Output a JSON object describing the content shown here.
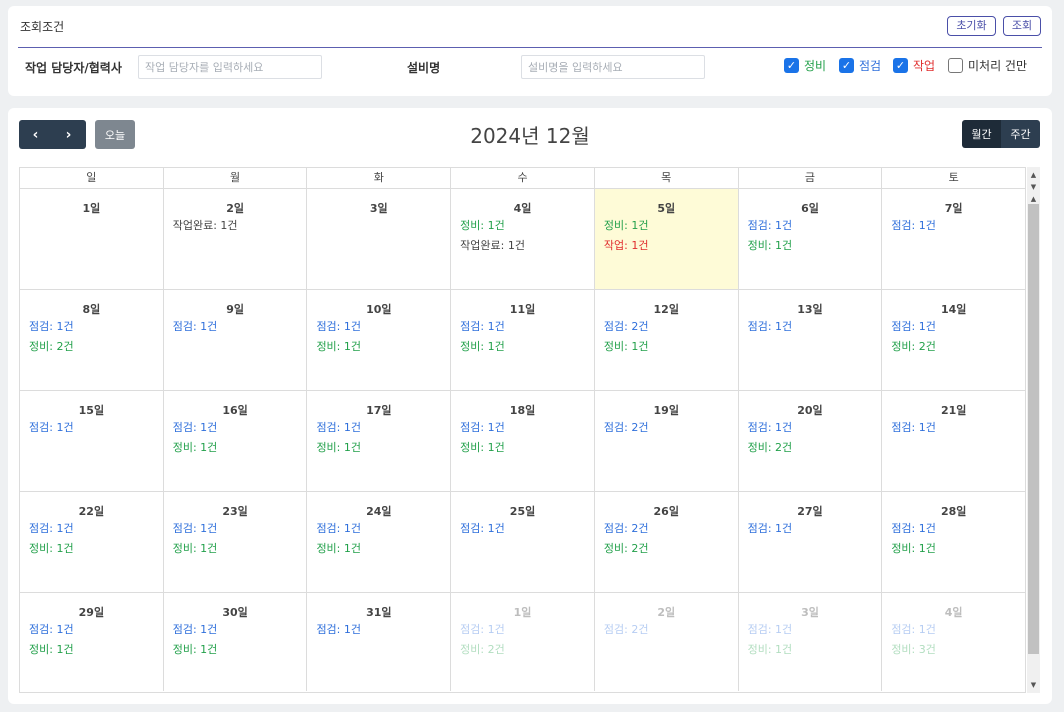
{
  "search": {
    "title": "조회조건",
    "reset_label": "초기화",
    "query_label": "조회",
    "worker_label": "작업 담당자/협력사",
    "worker_placeholder": "작업 담당자를 입력하세요",
    "equip_label": "설비명",
    "equip_placeholder": "설비명을 입력하세요",
    "filters": [
      {
        "label": "정비",
        "checked": true,
        "color": "#22a04a"
      },
      {
        "label": "점검",
        "checked": true,
        "color": "#2f6fdb"
      },
      {
        "label": "작업",
        "checked": true,
        "color": "#e02d2d"
      },
      {
        "label": "미처리 건만",
        "checked": false,
        "color": "#333333"
      }
    ]
  },
  "calendar": {
    "title": "2024년 12월",
    "prev_icon": "‹",
    "next_icon": "›",
    "today_label": "오늘",
    "month_label": "월간",
    "week_label": "주간",
    "weekdays": [
      "일",
      "월",
      "화",
      "수",
      "목",
      "금",
      "토"
    ],
    "weeks": [
      [
        {
          "day": "1일",
          "events": []
        },
        {
          "day": "2일",
          "events": [
            {
              "type": "done",
              "text": "작업완료: 1건"
            }
          ]
        },
        {
          "day": "3일",
          "events": []
        },
        {
          "day": "4일",
          "events": [
            {
              "type": "jeongbi",
              "text": "정비: 1건"
            },
            {
              "type": "done",
              "text": "작업완료: 1건"
            }
          ]
        },
        {
          "day": "5일",
          "today": true,
          "events": [
            {
              "type": "jeongbi",
              "text": "정비: 1건"
            },
            {
              "type": "jakeop",
              "text": "작업: 1건"
            }
          ]
        },
        {
          "day": "6일",
          "events": [
            {
              "type": "jeomgeom",
              "text": "점검: 1건"
            },
            {
              "type": "jeongbi",
              "text": "정비: 1건"
            }
          ]
        },
        {
          "day": "7일",
          "events": [
            {
              "type": "jeomgeom",
              "text": "점검: 1건"
            }
          ]
        }
      ],
      [
        {
          "day": "8일",
          "events": [
            {
              "type": "jeomgeom",
              "text": "점검: 1건"
            },
            {
              "type": "jeongbi",
              "text": "정비: 2건"
            }
          ]
        },
        {
          "day": "9일",
          "events": [
            {
              "type": "jeomgeom",
              "text": "점검: 1건"
            }
          ]
        },
        {
          "day": "10일",
          "events": [
            {
              "type": "jeomgeom",
              "text": "점검: 1건"
            },
            {
              "type": "jeongbi",
              "text": "정비: 1건"
            }
          ]
        },
        {
          "day": "11일",
          "events": [
            {
              "type": "jeomgeom",
              "text": "점검: 1건"
            },
            {
              "type": "jeongbi",
              "text": "정비: 1건"
            }
          ]
        },
        {
          "day": "12일",
          "events": [
            {
              "type": "jeomgeom",
              "text": "점검: 2건"
            },
            {
              "type": "jeongbi",
              "text": "정비: 1건"
            }
          ]
        },
        {
          "day": "13일",
          "events": [
            {
              "type": "jeomgeom",
              "text": "점검: 1건"
            }
          ]
        },
        {
          "day": "14일",
          "events": [
            {
              "type": "jeomgeom",
              "text": "점검: 1건"
            },
            {
              "type": "jeongbi",
              "text": "정비: 2건"
            }
          ]
        }
      ],
      [
        {
          "day": "15일",
          "events": [
            {
              "type": "jeomgeom",
              "text": "점검: 1건"
            }
          ]
        },
        {
          "day": "16일",
          "events": [
            {
              "type": "jeomgeom",
              "text": "점검: 1건"
            },
            {
              "type": "jeongbi",
              "text": "정비: 1건"
            }
          ]
        },
        {
          "day": "17일",
          "events": [
            {
              "type": "jeomgeom",
              "text": "점검: 1건"
            },
            {
              "type": "jeongbi",
              "text": "정비: 1건"
            }
          ]
        },
        {
          "day": "18일",
          "events": [
            {
              "type": "jeomgeom",
              "text": "점검: 1건"
            },
            {
              "type": "jeongbi",
              "text": "정비: 1건"
            }
          ]
        },
        {
          "day": "19일",
          "events": [
            {
              "type": "jeomgeom",
              "text": "점검: 2건"
            }
          ]
        },
        {
          "day": "20일",
          "events": [
            {
              "type": "jeomgeom",
              "text": "점검: 1건"
            },
            {
              "type": "jeongbi",
              "text": "정비: 2건"
            }
          ]
        },
        {
          "day": "21일",
          "events": [
            {
              "type": "jeomgeom",
              "text": "점검: 1건"
            }
          ]
        }
      ],
      [
        {
          "day": "22일",
          "events": [
            {
              "type": "jeomgeom",
              "text": "점검: 1건"
            },
            {
              "type": "jeongbi",
              "text": "정비: 1건"
            }
          ]
        },
        {
          "day": "23일",
          "events": [
            {
              "type": "jeomgeom",
              "text": "점검: 1건"
            },
            {
              "type": "jeongbi",
              "text": "정비: 1건"
            }
          ]
        },
        {
          "day": "24일",
          "events": [
            {
              "type": "jeomgeom",
              "text": "점검: 1건"
            },
            {
              "type": "jeongbi",
              "text": "정비: 1건"
            }
          ]
        },
        {
          "day": "25일",
          "events": [
            {
              "type": "jeomgeom",
              "text": "점검: 1건"
            }
          ]
        },
        {
          "day": "26일",
          "events": [
            {
              "type": "jeomgeom",
              "text": "점검: 2건"
            },
            {
              "type": "jeongbi",
              "text": "정비: 2건"
            }
          ]
        },
        {
          "day": "27일",
          "events": [
            {
              "type": "jeomgeom",
              "text": "점검: 1건"
            }
          ]
        },
        {
          "day": "28일",
          "events": [
            {
              "type": "jeomgeom",
              "text": "점검: 1건"
            },
            {
              "type": "jeongbi",
              "text": "정비: 1건"
            }
          ]
        }
      ],
      [
        {
          "day": "29일",
          "events": [
            {
              "type": "jeomgeom",
              "text": "점검: 1건"
            },
            {
              "type": "jeongbi",
              "text": "정비: 1건"
            }
          ]
        },
        {
          "day": "30일",
          "events": [
            {
              "type": "jeomgeom",
              "text": "점검: 1건"
            },
            {
              "type": "jeongbi",
              "text": "정비: 1건"
            }
          ]
        },
        {
          "day": "31일",
          "events": [
            {
              "type": "jeomgeom",
              "text": "점검: 1건"
            }
          ]
        },
        {
          "day": "1일",
          "other": true,
          "events": [
            {
              "type": "jeomgeom",
              "text": "점검: 1건"
            },
            {
              "type": "jeongbi",
              "text": "정비: 2건"
            }
          ]
        },
        {
          "day": "2일",
          "other": true,
          "events": [
            {
              "type": "jeomgeom",
              "text": "점검: 2건"
            }
          ]
        },
        {
          "day": "3일",
          "other": true,
          "events": [
            {
              "type": "jeomgeom",
              "text": "점검: 1건"
            },
            {
              "type": "jeongbi",
              "text": "정비: 1건"
            }
          ]
        },
        {
          "day": "4일",
          "other": true,
          "events": [
            {
              "type": "jeomgeom",
              "text": "점검: 1건"
            },
            {
              "type": "jeongbi",
              "text": "정비: 3건"
            }
          ]
        }
      ]
    ]
  }
}
